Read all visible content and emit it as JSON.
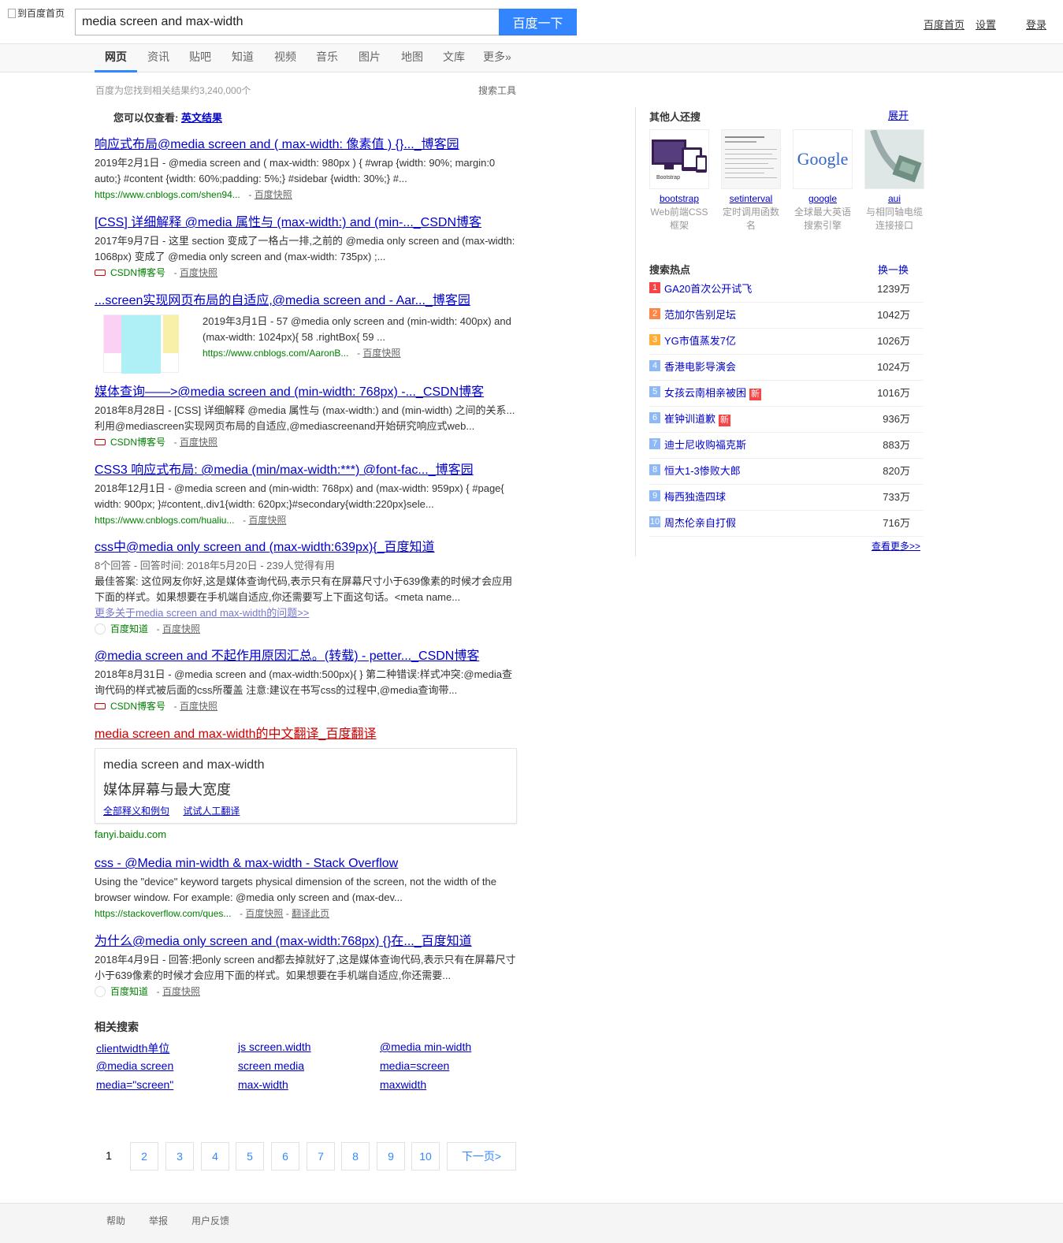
{
  "header": {
    "logo_alt": "到百度首页",
    "query": "media screen and max-width",
    "search_button": "百度一下",
    "links": [
      "百度首页",
      "设置",
      "登录"
    ]
  },
  "tabs": [
    "网页",
    "资讯",
    "贴吧",
    "知道",
    "视频",
    "音乐",
    "图片",
    "地图",
    "文库",
    "更多»"
  ],
  "meta": {
    "result_count": "百度为您找到相关结果约3,240,000个",
    "search_tools": "搜索工具",
    "only_view_label": "您可以仅查看:",
    "only_view_link": "英文结果"
  },
  "results": [
    {
      "title": "响应式布局@media screen and ( max-width: 像素值 ) {}..._博客园",
      "abstract": "2019年2月1日 - @media screen and ( max-width: 980px ) { #wrap {width: 90%; margin:0 auto;} #content {width: 60%;padding: 5%;} #sidebar {width: 30%;} #...",
      "source": "https://www.cnblogs.com/shen94...",
      "snapshot": "百度快照"
    },
    {
      "title": "[CSS] 详细解释 @media 属性与 (max-width:) and (min-..._CSDN博客",
      "abstract": "2017年9月7日 - 这里 section 变成了一格占一排,之前的 @media only screen and (max-width: 1068px) 变成了 @media only screen and (max-width: 735px) ;...",
      "source": "CSDN博客号",
      "snapshot": "百度快照"
    },
    {
      "title": "...screen实现网页布局的自适应,@media screen and - Aar..._博客园",
      "abstract": "2019年3月1日 - 57 @media only screen and (min-width: 400px) and (max-width: 1024px){ 58 .rightBox{ 59 ...",
      "source": "https://www.cnblogs.com/AaronB...",
      "snapshot": "百度快照"
    },
    {
      "title": "媒体查询——>@media screen and (min-width: 768px) -..._CSDN博客",
      "abstract": "2018年8月28日 - [CSS] 详细解释 @media 属性与 (max-width:) and (min-width) 之间的关系...利用@mediascreen实现网页布局的自适应,@mediascreenand开始研究响应式web...",
      "source": "CSDN博客号",
      "snapshot": "百度快照"
    },
    {
      "title": "CSS3 响应式布局: @media (min/max-width:***) @font-fac..._博客园",
      "abstract": "2018年12月1日 - @media screen and (min-width: 768px) and (max-width: 959px) { #page{ width: 900px; }#content,.div1{width: 620px;}#secondary{width:220px}sele...",
      "source": "https://www.cnblogs.com/hualiu...",
      "snapshot": "百度快照"
    },
    {
      "title": "css中@media only screen and (max-width:639px){_百度知道",
      "meta": "8个回答 - 回答时间: 2018年5月20日 - 239人觉得有用",
      "abstract": "最佳答案: 这位网友你好,这是媒体查询代码,表示只有在屏幕尺寸小于639像素的时候才会应用下面的样式。如果想要在手机端自适应,你还需要写上下面这句话。<meta name...",
      "more": "更多关于media screen and max-width的问题>>",
      "source": "百度知道",
      "snapshot": "百度快照"
    },
    {
      "title": "@media screen and 不起作用原因汇总。(转载) - petter..._CSDN博客",
      "abstract": "2018年8月31日 - @media screen and (max-width:500px){ } 第二种错误:样式冲突:@media查询代码的样式被后面的css所覆盖 注意:建议在书写css的过程中,@media查询带...",
      "source": "CSDN博客号",
      "snapshot": "百度快照"
    },
    {
      "title": "media screen and max-width的中文翻译_百度翻译"
    },
    {
      "title": "css - @Media min-width & max-width - Stack Overflow",
      "abstract": "Using the \"device\" keyword targets physical dimension of the screen, not the width of the browser window. For example: @media only screen and (max-dev...",
      "source": "https://stackoverflow.com/ques...",
      "snapshot": "百度快照",
      "translate": "翻译此页"
    },
    {
      "title": "为什么@media only screen and (max-width:768px) {}在..._百度知道",
      "abstract": "2018年4月9日 - 回答:把only screen and都去掉就好了,这是媒体查询代码,表示只有在屏幕尺寸小于639像素的时候才会应用下面的样式。如果想要在手机端自适应,你还需要...",
      "source": "百度知道",
      "snapshot": "百度快照"
    }
  ],
  "fanyi": {
    "source": "media screen and max-width",
    "target": "媒体屏幕与最大宽度",
    "link1": "全部释义和例句",
    "link2": "试试人工翻译",
    "url": "fanyi.baidu.com"
  },
  "related": {
    "title": "相关搜索",
    "items": [
      "clientwidth单位",
      "js screen.width",
      "@media min-width",
      "@media screen",
      "screen media",
      "media=screen",
      "media=\"screen\"",
      "max-width",
      "maxwidth"
    ]
  },
  "pager": {
    "current": "1",
    "pages": [
      "2",
      "3",
      "4",
      "5",
      "6",
      "7",
      "8",
      "9",
      "10"
    ],
    "next": "下一页>"
  },
  "footer": [
    "帮助",
    "举报",
    "用户反馈"
  ],
  "right": {
    "others_title": "其他人还搜",
    "expand": "展开",
    "cards": [
      {
        "name": "bootstrap",
        "desc": "Web前端CSS框架"
      },
      {
        "name": "setinterval",
        "desc": "定时调用函数名"
      },
      {
        "name": "google",
        "desc": "全球最大英语搜索引擎"
      },
      {
        "name": "aui",
        "desc": "与相同轴电缆连接接口"
      }
    ],
    "card_logo_text": "Bootstrap",
    "google_logo": "Google",
    "hot_title": "搜索热点",
    "hot_refresh": "换一换",
    "hot": [
      {
        "rank": "1",
        "title": "GA20首次公开试飞",
        "count": "1239万"
      },
      {
        "rank": "2",
        "title": "范加尔告别足坛",
        "count": "1042万"
      },
      {
        "rank": "3",
        "title": "YG市值蒸发7亿",
        "count": "1026万"
      },
      {
        "rank": "4",
        "title": "香港电影导演会",
        "count": "1024万"
      },
      {
        "rank": "5",
        "title": "女孩云南相亲被困",
        "count": "1016万",
        "badge": "新"
      },
      {
        "rank": "6",
        "title": "崔钟训道歉",
        "count": "936万",
        "badge": "新"
      },
      {
        "rank": "7",
        "title": "迪士尼收购福克斯",
        "count": "883万"
      },
      {
        "rank": "8",
        "title": "恒大1-3惨败大郎",
        "count": "820万"
      },
      {
        "rank": "9",
        "title": "梅西独造四球",
        "count": "733万"
      },
      {
        "rank": "10",
        "title": "周杰伦亲自打假",
        "count": "716万"
      }
    ],
    "see_more": "查看更多>>"
  },
  "colors": {
    "link": "#0000cc",
    "highlight": "#cc0000",
    "url_green": "#008000",
    "brand_blue": "#3385ff"
  }
}
